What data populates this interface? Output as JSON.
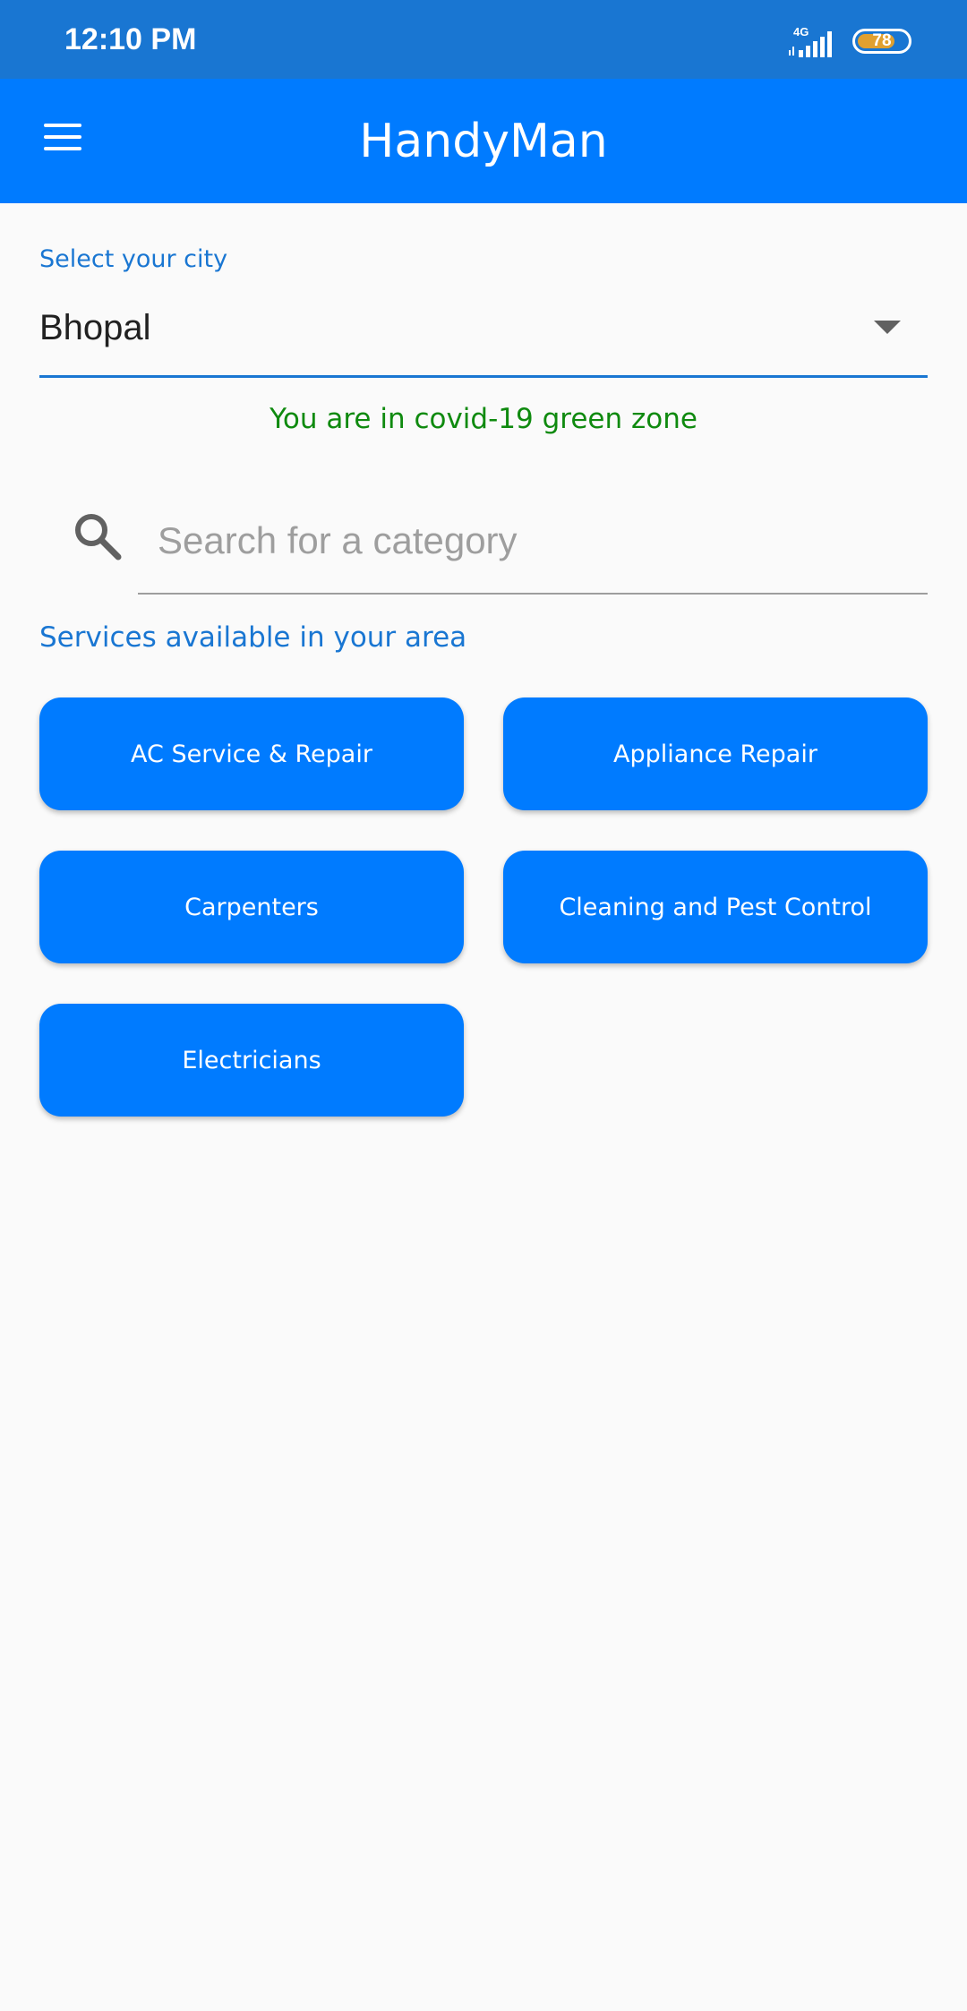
{
  "status_bar": {
    "time": "12:10 PM",
    "network": "4G",
    "battery": "78",
    "battery_level": 0.78,
    "icons": [
      "signal-icon",
      "battery-icon"
    ]
  },
  "app_bar": {
    "title": "HandyMan",
    "menu_icon": "menu-icon"
  },
  "city": {
    "label": "Select your city",
    "value": "Bhopal"
  },
  "covid_status": "You are in covid-19 green zone",
  "search": {
    "placeholder": "Search for a category",
    "value": "",
    "icon": "search-icon"
  },
  "services": {
    "heading": "Services available in your area",
    "items": [
      {
        "label": "AC Service & Repair"
      },
      {
        "label": "Appliance Repair"
      },
      {
        "label": "Carpenters"
      },
      {
        "label": "Cleaning and Pest Control"
      },
      {
        "label": "Electricians"
      }
    ]
  },
  "colors": {
    "status_bar": "#1976d2",
    "app_bar": "#007bff",
    "accent": "#1976d2",
    "covid_green": "#0f8a0f",
    "battery": "#e0a030",
    "background": "#fafafa"
  }
}
